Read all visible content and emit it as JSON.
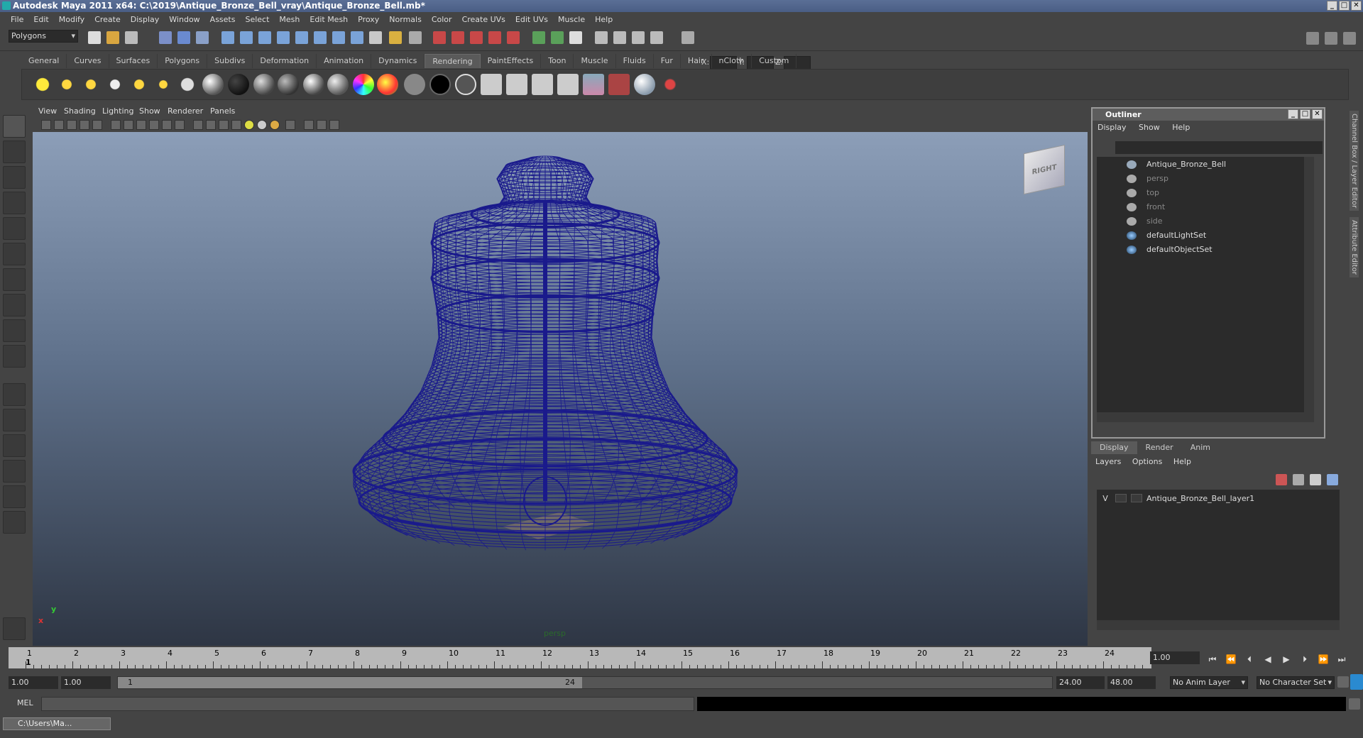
{
  "window": {
    "title": "Autodesk Maya 2011 x64: C:\\2019\\Antique_Bronze_Bell_vray\\Antique_Bronze_Bell.mb*"
  },
  "menubar": [
    "File",
    "Edit",
    "Modify",
    "Create",
    "Display",
    "Window",
    "Assets",
    "Select",
    "Mesh",
    "Edit Mesh",
    "Proxy",
    "Normals",
    "Color",
    "Create UVs",
    "Edit UVs",
    "Muscle",
    "Help"
  ],
  "statusline": {
    "mode": "Polygons",
    "x_label": "X:",
    "y_label": "Y:",
    "z_label": "Z:"
  },
  "shelf": {
    "tabs": [
      "General",
      "Curves",
      "Surfaces",
      "Polygons",
      "Subdivs",
      "Deformation",
      "Animation",
      "Dynamics",
      "Rendering",
      "PaintEffects",
      "Toon",
      "Muscle",
      "Fluids",
      "Fur",
      "Hair",
      "nCloth",
      "Custom"
    ],
    "active_tab": "Rendering"
  },
  "viewport": {
    "menu": [
      "View",
      "Shading",
      "Lighting",
      "Show",
      "Renderer",
      "Panels"
    ],
    "camera_label": "persp",
    "viewcube_label": "RIGHT",
    "axis_y": "y",
    "axis_x": "x",
    "wire_color": "#1a1a8c"
  },
  "outliner": {
    "title": "Outliner",
    "menu": [
      "Display",
      "Show",
      "Help"
    ],
    "items": [
      {
        "label": "Antique_Bronze_Bell",
        "icon": "transform-icon",
        "dim": false
      },
      {
        "label": "persp",
        "icon": "camera-icon",
        "dim": true
      },
      {
        "label": "top",
        "icon": "camera-icon",
        "dim": true
      },
      {
        "label": "front",
        "icon": "camera-icon",
        "dim": true
      },
      {
        "label": "side",
        "icon": "camera-icon",
        "dim": true
      },
      {
        "label": "defaultLightSet",
        "icon": "set-icon",
        "dim": false
      },
      {
        "label": "defaultObjectSet",
        "icon": "set-icon",
        "dim": false
      }
    ]
  },
  "side_tabs": [
    "Channel Box / Layer Editor",
    "Attribute Editor"
  ],
  "layers": {
    "tabs": [
      "Display",
      "Render",
      "Anim"
    ],
    "active_tab": "Display",
    "menu": [
      "Layers",
      "Options",
      "Help"
    ],
    "rows": [
      {
        "visible": "V",
        "name": "Antique_Bronze_Bell_layer1"
      }
    ]
  },
  "timeline": {
    "ticks": [
      "1",
      "2",
      "3",
      "4",
      "5",
      "6",
      "7",
      "8",
      "9",
      "10",
      "11",
      "12",
      "13",
      "14",
      "15",
      "16",
      "17",
      "18",
      "19",
      "20",
      "21",
      "22",
      "23",
      "24"
    ],
    "current_frame_marker": "1",
    "current_frame": "1.00"
  },
  "range": {
    "start": "1.00",
    "playback_start": "1.00",
    "slider_start": "1",
    "slider_end": "24",
    "playback_end": "24.00",
    "end": "48.00",
    "anim_layer": "No Anim Layer",
    "character_set": "No Character Set"
  },
  "command": {
    "label": "MEL"
  },
  "taskbar": {
    "label": "C:\\Users\\Ma..."
  }
}
